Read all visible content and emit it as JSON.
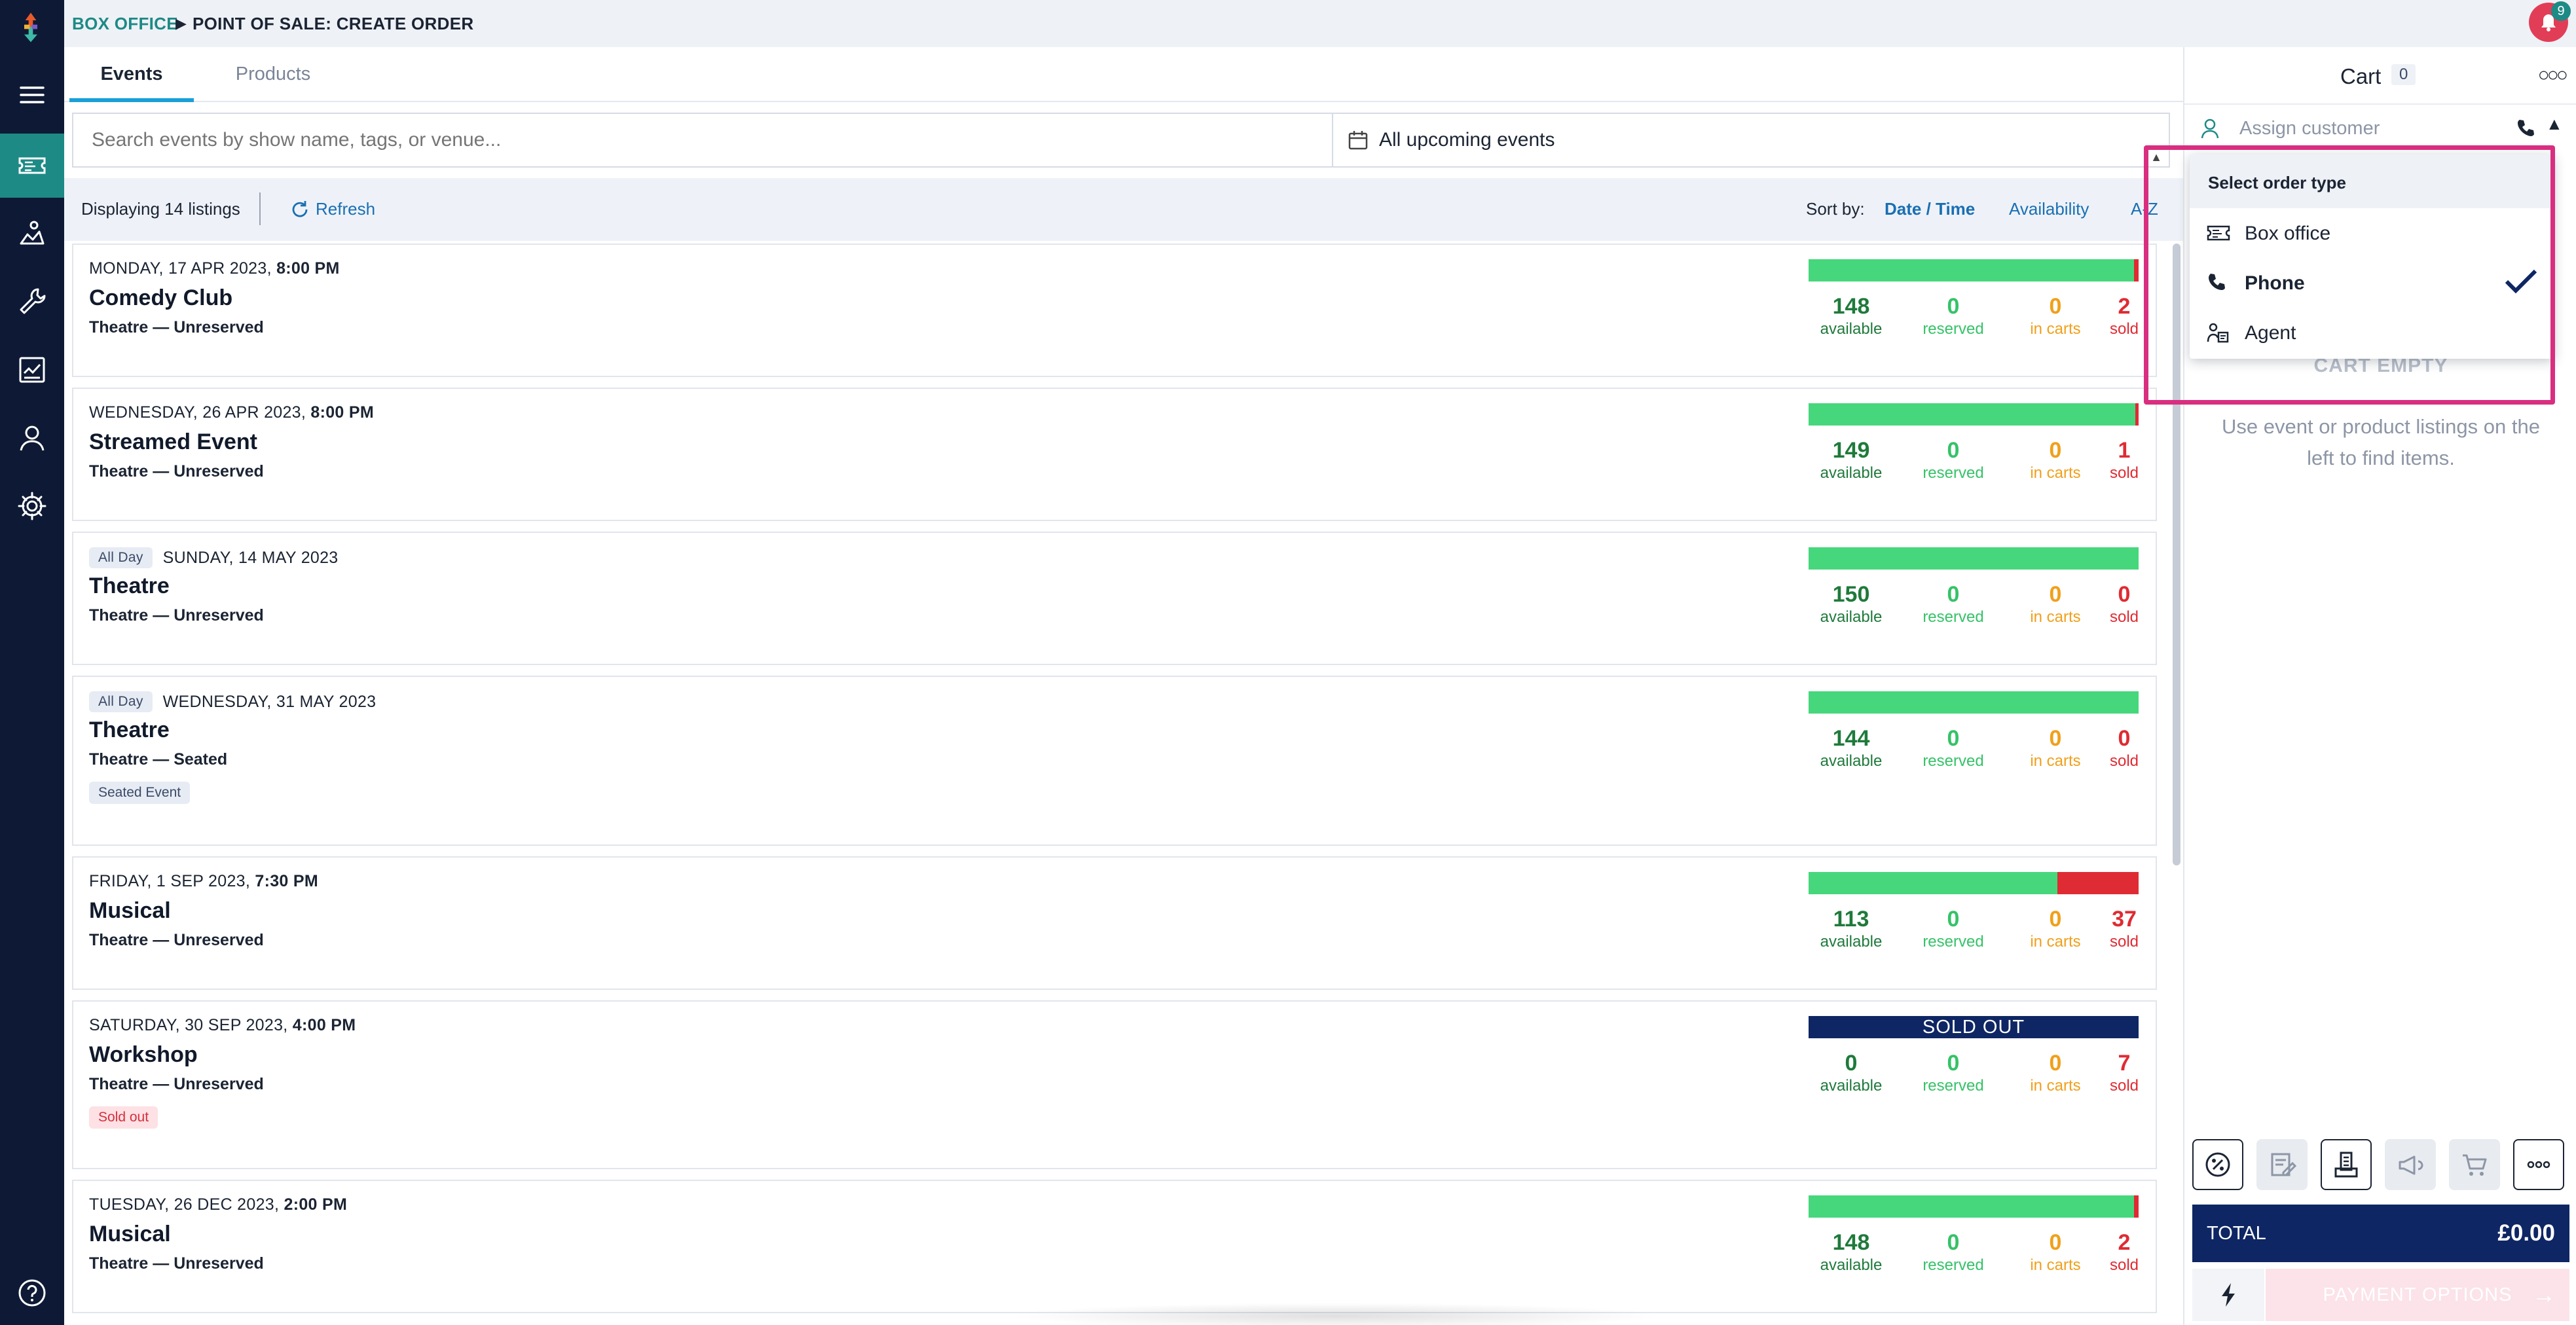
{
  "breadcrumb": {
    "section": "BOX OFFICE",
    "page": "POINT OF SALE: CREATE ORDER"
  },
  "notifications": {
    "count": "9"
  },
  "tabs": [
    {
      "label": "Events"
    },
    {
      "label": "Products"
    }
  ],
  "search": {
    "placeholder": "Search events by show name, tags, or venue..."
  },
  "date_filter": {
    "value": "All upcoming events"
  },
  "listing_bar": {
    "count_text": "Displaying 14 listings",
    "refresh_label": "Refresh",
    "sort_label": "Sort by:",
    "sort_options": [
      "Date / Time",
      "Availability",
      "A-Z"
    ]
  },
  "stat_labels": {
    "available": "available",
    "reserved": "reserved",
    "in_carts": "in carts",
    "sold": "sold"
  },
  "events": [
    {
      "date": "MONDAY, 17 APR 2023,",
      "time": "8:00 PM",
      "all_day": "",
      "title": "Comedy Club",
      "venue": "Theatre — Unreserved",
      "tag": "",
      "available": "148",
      "reserved": "0",
      "in_carts": "0",
      "sold": "2",
      "sold_fraction": 0.013
    },
    {
      "date": "WEDNESDAY, 26 APR 2023,",
      "time": "8:00 PM",
      "all_day": "",
      "title": "Streamed Event",
      "venue": "Theatre — Unreserved",
      "tag": "",
      "available": "149",
      "reserved": "0",
      "in_carts": "0",
      "sold": "1",
      "sold_fraction": 0.007
    },
    {
      "date": "SUNDAY, 14 MAY 2023",
      "time": "",
      "all_day": "All Day",
      "title": "Theatre",
      "venue": "Theatre — Unreserved",
      "tag": "",
      "available": "150",
      "reserved": "0",
      "in_carts": "0",
      "sold": "0",
      "sold_fraction": 0
    },
    {
      "date": "WEDNESDAY, 31 MAY 2023",
      "time": "",
      "all_day": "All Day",
      "title": "Theatre",
      "venue": "Theatre — Seated",
      "tag": "Seated Event",
      "available": "144",
      "reserved": "0",
      "in_carts": "0",
      "sold": "0",
      "sold_fraction": 0
    },
    {
      "date": "FRIDAY, 1 SEP 2023,",
      "time": "7:30 PM",
      "all_day": "",
      "title": "Musical",
      "venue": "Theatre — Unreserved",
      "tag": "",
      "available": "113",
      "reserved": "0",
      "in_carts": "0",
      "sold": "37",
      "sold_fraction": 0.247
    },
    {
      "date": "SATURDAY, 30 SEP 2023,",
      "time": "4:00 PM",
      "all_day": "",
      "title": "Workshop",
      "venue": "Theatre — Unreserved",
      "tag": "Sold out",
      "available": "0",
      "reserved": "0",
      "in_carts": "0",
      "sold": "7",
      "sold_fraction": 1,
      "sold_out_label": "SOLD OUT"
    },
    {
      "date": "TUESDAY, 26 DEC 2023,",
      "time": "2:00 PM",
      "all_day": "",
      "title": "Musical",
      "venue": "Theatre — Unreserved",
      "tag": "",
      "available": "148",
      "reserved": "0",
      "in_carts": "0",
      "sold": "2",
      "sold_fraction": 0.013
    }
  ],
  "cart": {
    "title": "Cart",
    "count": "0",
    "assign_placeholder": "Assign customer",
    "empty_title": "CART EMPTY",
    "empty_message": "Use event or product listings on the left to find items.",
    "total_label": "TOTAL",
    "total_value": "£0.00",
    "payment_label": "PAYMENT OPTIONS"
  },
  "order_type_menu": {
    "header": "Select order type",
    "options": [
      {
        "label": "Box office",
        "icon": "ticket-icon",
        "selected": false
      },
      {
        "label": "Phone",
        "icon": "phone-icon",
        "selected": true
      },
      {
        "label": "Agent",
        "icon": "agent-icon",
        "selected": false
      }
    ]
  },
  "colors": {
    "accent": "#1d8a86",
    "nav_bg": "#0e1a35",
    "available_bar": "#46d77c",
    "sold_bar": "#df2b33",
    "total_bg": "#0e2663",
    "highlight": "#d92e80"
  }
}
